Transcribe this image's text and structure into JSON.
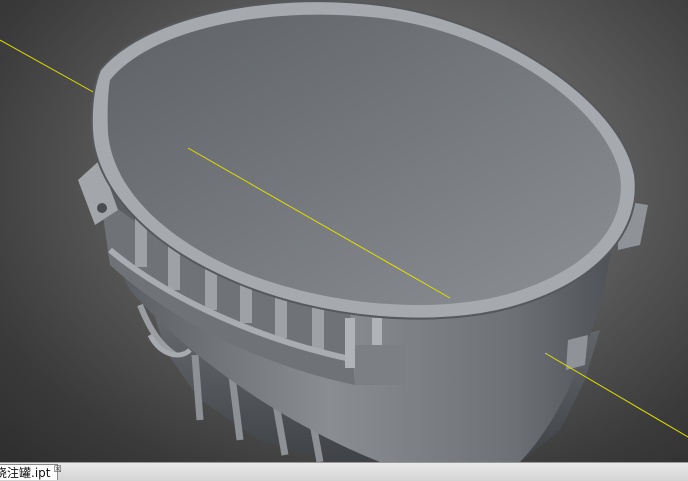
{
  "document_tab": {
    "label": "浇注罐.ipt",
    "close_symbol": "☒",
    "close_icon": "close-icon"
  },
  "viewport": {
    "background": "#5c5c5c",
    "axis_color": "#e0e000",
    "part_color": "#808388"
  }
}
